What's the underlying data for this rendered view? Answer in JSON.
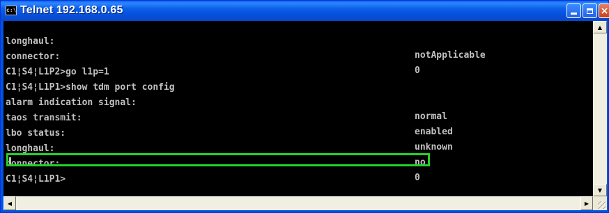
{
  "window": {
    "title": "Telnet 192.168.0.65",
    "icon": "console-icon",
    "icon_glyph": "c:\\",
    "minimize_icon": "minimize-icon",
    "maximize_icon": "maximize-icon",
    "close_icon": "close-icon",
    "close_glyph": "×"
  },
  "console": {
    "lines": [
      {
        "key": "longhaul:",
        "value": "notApplicable"
      },
      {
        "key": "connector:",
        "value": "0"
      },
      {
        "key": "C1¦S4¦L1P2>go l1p=1",
        "value": ""
      },
      {
        "key": "C1¦S4¦L1P1>show tdm port config",
        "value": ""
      },
      {
        "key": "alarm indication signal:",
        "value": "normal"
      },
      {
        "key": "taos transmit:",
        "value": "enabled"
      },
      {
        "key": "lbo status:",
        "value": "unknown"
      },
      {
        "key": "longhaul:",
        "value": "no"
      },
      {
        "key": "connector:",
        "value": "0"
      },
      {
        "key": "C1¦S4¦L1P1>",
        "value": ""
      }
    ],
    "highlighted_line_index": 8,
    "highlight_color": "#24d12a",
    "text_color": "#c0c0c0",
    "background_color": "#000000"
  },
  "scrollbars": {
    "up_arrow": "▲",
    "down_arrow": "▼",
    "left_arrow": "◀",
    "right_arrow": "▶"
  }
}
